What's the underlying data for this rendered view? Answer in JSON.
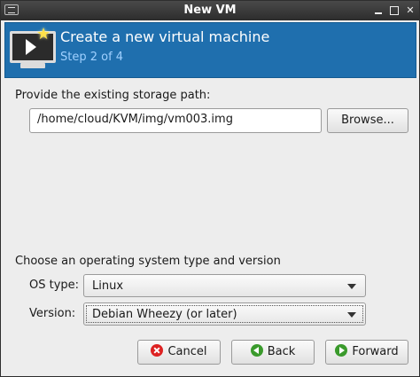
{
  "window": {
    "title": "New VM"
  },
  "header": {
    "title": "Create a new virtual machine",
    "step": "Step 2 of 4",
    "icon": "vm-monitor-play-icon"
  },
  "storage": {
    "label": "Provide the existing storage path:",
    "path_value": "/home/cloud/KVM/img/vm003.img",
    "browse_label": "Browse..."
  },
  "os": {
    "section_label": "Choose an operating system type and version",
    "type_label": "OS type:",
    "type_value": "Linux",
    "version_label": "Version:",
    "version_value": "Debian Wheezy (or later)"
  },
  "buttons": {
    "cancel": "Cancel",
    "back": "Back",
    "forward": "Forward"
  },
  "colors": {
    "header_bg": "#1f6fae",
    "step_text": "#9fd0ff",
    "window_bg": "#ededed"
  }
}
